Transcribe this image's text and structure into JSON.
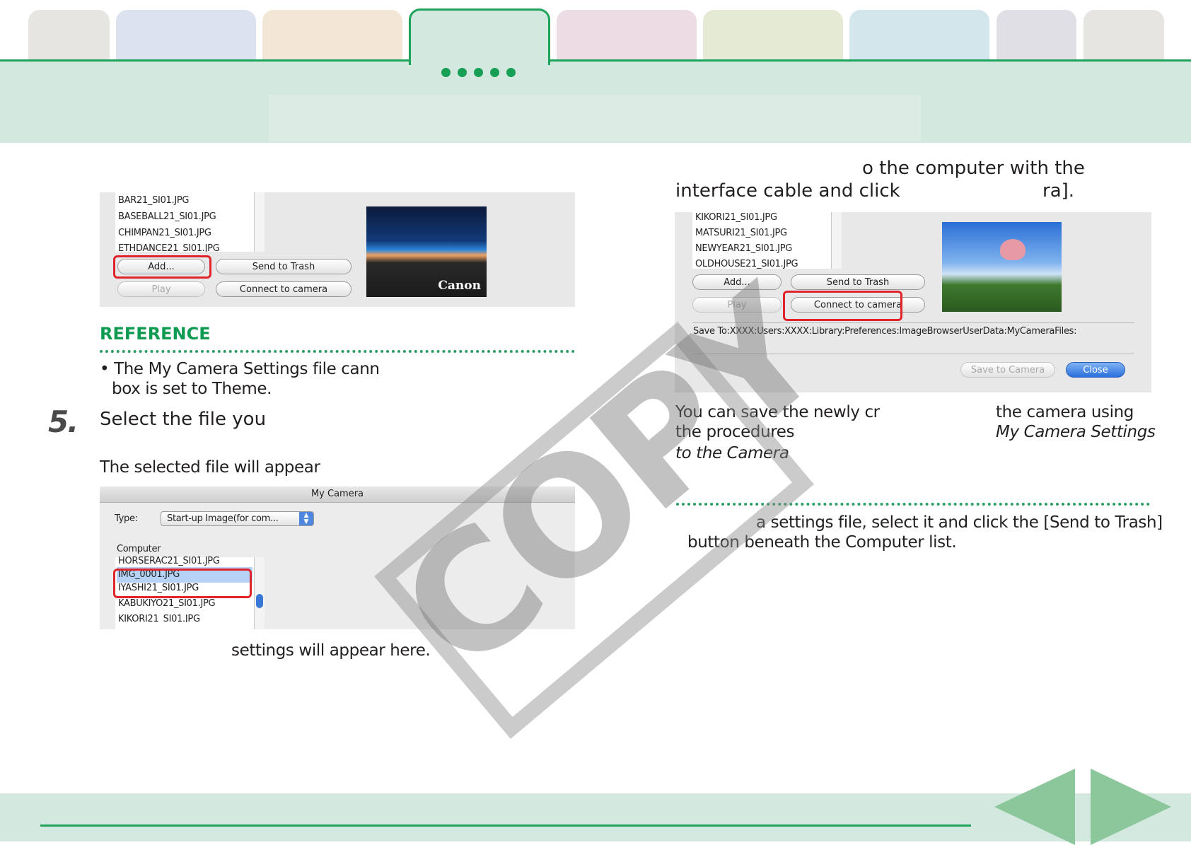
{
  "colors": {
    "accent_green": "#1ea35a",
    "header_band": "#d3e8de",
    "highlight_red": "#e0242c",
    "reference_green": "#0e9a50"
  },
  "step": {
    "number": "5.",
    "title": "Select the file you"
  },
  "top_left_shot": {
    "files": [
      "BAR21_SI01.JPG",
      "BASEBALL21_SI01.JPG",
      "CHIMPAN21_SI01.JPG",
      "ETHDANCE21_SI01.JPG"
    ],
    "add_label": "Add...",
    "send_trash_label": "Send to Trash",
    "play_label": "Play",
    "connect_label": "Connect to camera",
    "logo_text": "Canon"
  },
  "reference": {
    "heading": "REFERENCE",
    "line1": "• The My Camera Settings file cann",
    "line2": "box is set to Theme."
  },
  "selected_note": "The selected file will appear",
  "dialog": {
    "title": "My Camera",
    "type_label": "Type:",
    "type_value": "Start-up Image(for com...",
    "computer_label": "Computer",
    "files": [
      "HORSERAC21_SI01.JPG",
      "IMG_0001.JPG",
      "IYASHI21_SI01.JPG",
      "KABUKIYO21_SI01.JPG",
      "KIKORI21_SI01.JPG"
    ]
  },
  "settings_note": "settings will appear here.",
  "right_intro": {
    "line1": "o the computer with the",
    "line2a": "interface cable and click",
    "line2b": "ra]."
  },
  "right_shot": {
    "files": [
      "KIKORI21_SI01.JPG",
      "MATSURI21_SI01.JPG",
      "NEWYEAR21_SI01.JPG",
      "OLDHOUSE21_SI01.JPG"
    ],
    "add_label": "Add...",
    "send_trash_label": "Send to Trash",
    "play_label": "Play",
    "connect_label": "Connect to camera",
    "save_to_path": "Save To:XXXX:Users:XXXX:Library:Preferences:ImageBrowserUserData:MyCameraFiles:",
    "save_camera_label": "Save to Camera",
    "close_label": "Close"
  },
  "right_text": {
    "l1a": "You can save the newly cr",
    "l1b": "the camera using",
    "l2a": "the procedures",
    "l2b": "My Camera Settings",
    "l3": "to the Camera"
  },
  "right_note": {
    "line1": "a settings file, select it and click the [Send to Trash]",
    "line2": "button beneath the Computer list."
  },
  "watermark": "COPY",
  "nav": {
    "prev_icon": "left-triangle-icon",
    "next_icon": "right-triangle-icon"
  }
}
